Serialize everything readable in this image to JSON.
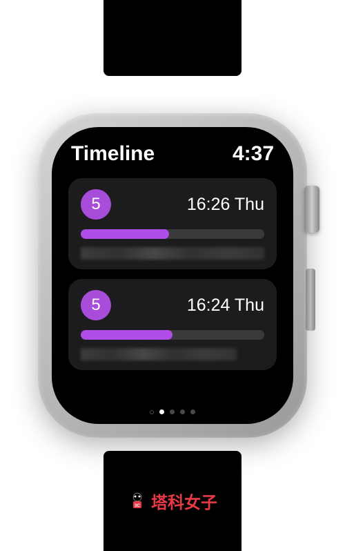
{
  "header": {
    "title": "Timeline",
    "time": "4:37"
  },
  "cards": [
    {
      "badge": "5",
      "timestamp": "16:26 Thu",
      "progress": 48
    },
    {
      "badge": "5",
      "timestamp": "16:24 Thu",
      "progress": 50
    }
  ],
  "pagination": {
    "total": 5,
    "active": 1
  },
  "branding": {
    "text": "塔科女子"
  }
}
